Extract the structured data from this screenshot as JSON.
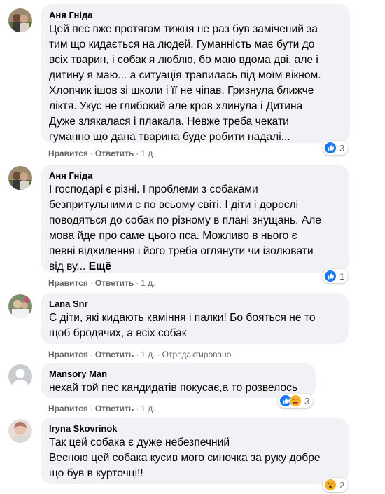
{
  "comments": [
    {
      "author": "Аня Гніда",
      "text": "Цей пес вже протягом тижня не раз був замічений за\nтим що кидається на людей. Гуманність має бути до\nвсіх тварин, і собак я люблю, бо маю вдома дві, але і\nдитину я маю... а ситуація трапилась під моїм вікном.\nХлопчик ішов зі школи і її не чіпав. Гризнула ближче\nліктя. Укус не глибокий але кров хлинула і Дитина\nДуже злякалася і плакала. Невже треба чекати\nгуманно що дана тварина буде робити надалі...",
      "like_label": "Нравится",
      "reply_label": "Ответить",
      "time": "1 д.",
      "edited": "",
      "more": "",
      "reaction_count": "3",
      "reaction_icons": [
        "like-icon"
      ]
    },
    {
      "author": "Аня Гніда",
      "text": "І господарі є різні. І проблеми з собаками\nбезпритульними є по всьому світі. І діти і дорослі\nповодяться до собак по різному в плані знущань. Але\nмова йде про саме цього пса. Можливо в нього є\nпевні відхилення і його треба оглянути чи ізолювати\nвід ву...",
      "like_label": "Нравится",
      "reply_label": "Ответить",
      "time": "1 д.",
      "edited": "",
      "more": "Ещё",
      "reaction_count": "1",
      "reaction_icons": [
        "like-icon"
      ]
    },
    {
      "author": "Lana Snr",
      "text": "Є діти, які кидають каміння і палки! Бо бояться не то\nщоб бродячих, а всіх собак",
      "like_label": "Нравится",
      "reply_label": "Ответить",
      "time": "1 д.",
      "edited": "Отредактировано",
      "more": "",
      "reaction_count": "",
      "reaction_icons": []
    },
    {
      "author": "Mansory Man",
      "text": "нехай той пес кандидатів покусає,а то розвелось",
      "like_label": "Нравится",
      "reply_label": "Ответить",
      "time": "1 д.",
      "edited": "",
      "more": "",
      "reaction_count": "3",
      "reaction_icons": [
        "like-icon",
        "laugh-icon"
      ]
    },
    {
      "author": "Iryna Skovrinok",
      "text": "Так цей собака є дуже небезпечний\nВесною цей собака кусив мого синочка за руку добре\nщо був в курточці!!",
      "like_label": "Нравится",
      "reply_label": "Ответить",
      "time": "1 д.",
      "edited": "",
      "more": "",
      "reaction_count": "2",
      "reaction_icons": [
        "wow-icon"
      ]
    }
  ],
  "colors": {
    "bubble": "#f0f2f5",
    "meta": "#65676b",
    "like_blue": "#1877f2",
    "wow_yellow": "#f7b125"
  }
}
